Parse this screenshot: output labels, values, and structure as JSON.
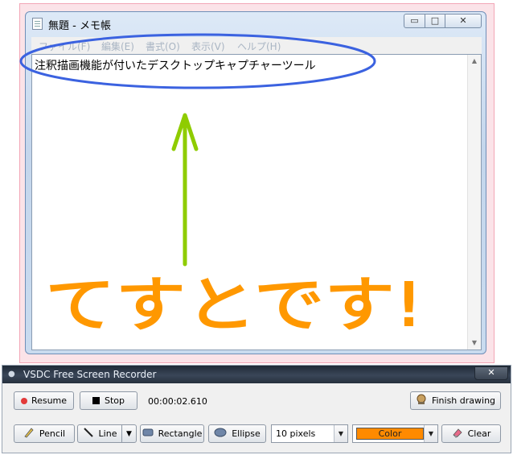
{
  "notepad": {
    "title": "無題 - メモ帳",
    "menu": [
      "ファイル(F)",
      "編集(E)",
      "書式(O)",
      "表示(V)",
      "ヘルプ(H)"
    ],
    "content": "注釈描画機能が付いたデスクトップキャプチャーツール",
    "window_buttons": {
      "minimize": "▭",
      "maximize": "□",
      "close": "✕"
    }
  },
  "annotations": {
    "handwritten_text": "てすとです!",
    "ellipse_color": "#3b62e0",
    "arrow_color": "#8fcc00",
    "text_color": "#ff9800"
  },
  "recorder": {
    "title": "VSDC Free Screen Recorder",
    "close_glyph": "✕",
    "resume_label": "Resume",
    "stop_label": "Stop",
    "timer": "00:00:02.610",
    "finish_label": "Finish drawing",
    "tools": {
      "pencil": "Pencil",
      "line": "Line",
      "rectangle": "Rectangle",
      "ellipse": "Ellipse",
      "size": "10 pixels",
      "color": "Color",
      "clear": "Clear"
    },
    "selected_color": "#ff8a00"
  }
}
